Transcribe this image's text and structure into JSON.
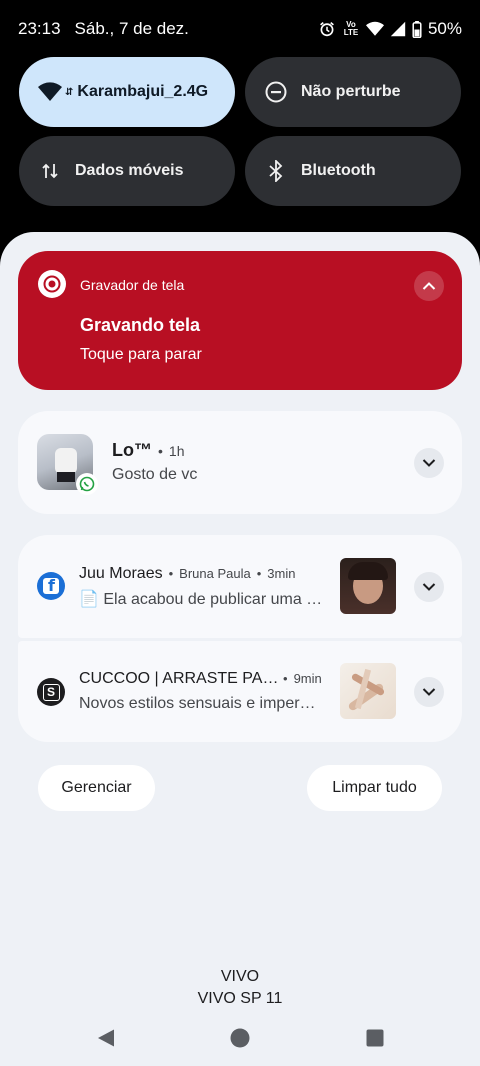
{
  "status_bar": {
    "time": "23:13",
    "date": "Sáb., 7 de dez.",
    "volte_label": "Vo\nLTE",
    "battery": "50%"
  },
  "quick_tiles": [
    {
      "label": "Karambajui_2.4G",
      "icon": "wifi-icon",
      "active": true
    },
    {
      "label": "Não perturbe",
      "icon": "dnd-icon",
      "active": false
    },
    {
      "label": "Dados móveis",
      "icon": "mobile-data-icon",
      "active": false
    },
    {
      "label": "Bluetooth",
      "icon": "bluetooth-icon",
      "active": false
    }
  ],
  "recorder": {
    "app": "Gravador de tela",
    "title": "Gravando tela",
    "text": "Toque para parar",
    "color": "#b80f23"
  },
  "notifications": [
    {
      "title": "Lo™",
      "time": "1h",
      "text": "Gosto de vc",
      "app_icon": "whatsapp-icon"
    },
    {
      "title": "Juu Moraes",
      "subtitle": "Bruna Paula",
      "time": "3min",
      "text": "📄 Ela acabou de publicar uma …",
      "app_icon": "facebook-icon"
    },
    {
      "title": "CUCCOO | ARRASTE PA…",
      "time": "9min",
      "text": "Novos estilos sensuais e imper…",
      "app_icon": "shein-icon"
    }
  ],
  "actions": {
    "manage": "Gerenciar",
    "clear_all": "Limpar tudo"
  },
  "carrier": {
    "line1": "VIVO",
    "line2": "VIVO SP 11"
  },
  "dot": "•"
}
